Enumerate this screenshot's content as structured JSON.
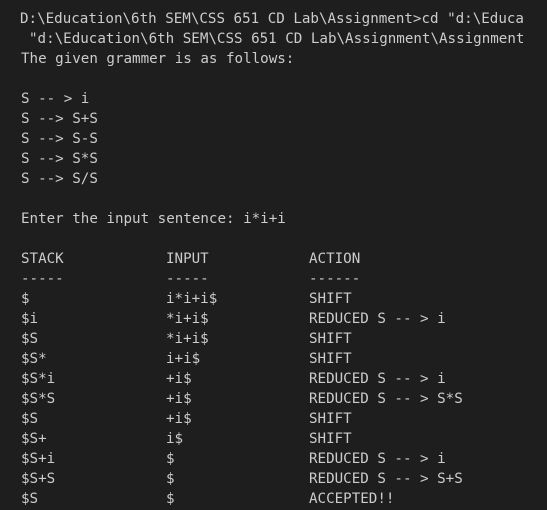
{
  "terminal": {
    "cmd_line_1": "D:\\Education\\6th SEM\\CSS 651 CD Lab\\Assignment>cd \"d:\\Educa",
    "cmd_line_2": "\"d:\\Education\\6th SEM\\CSS 651 CD Lab\\Assignment\\Assignment",
    "grammar_heading": "The given grammer is as follows:",
    "productions": [
      "S -- > i",
      "S --> S+S",
      "S --> S-S",
      "S --> S*S",
      "S --> S/S"
    ],
    "input_prompt": "Enter the input sentence: i*i+i",
    "table": {
      "headers": {
        "stack": "STACK",
        "input": "INPUT",
        "action": "ACTION"
      },
      "separators": {
        "stack": "-----",
        "input": "-----",
        "action": "------"
      },
      "rows": [
        {
          "stack": "$",
          "input": "i*i+i$",
          "action": "SHIFT"
        },
        {
          "stack": "$i",
          "input": "*i+i$",
          "action": "REDUCED S -- > i"
        },
        {
          "stack": "$S",
          "input": "*i+i$",
          "action": "SHIFT"
        },
        {
          "stack": "$S*",
          "input": "i+i$",
          "action": "SHIFT"
        },
        {
          "stack": "$S*i",
          "input": "+i$",
          "action": "REDUCED S -- > i"
        },
        {
          "stack": "$S*S",
          "input": "+i$",
          "action": "REDUCED S -- > S*S"
        },
        {
          "stack": "$S",
          "input": "+i$",
          "action": "SHIFT"
        },
        {
          "stack": "$S+",
          "input": "i$",
          "action": "SHIFT"
        },
        {
          "stack": "$S+i",
          "input": "$",
          "action": "REDUCED S -- > i"
        },
        {
          "stack": "$S+S",
          "input": "$",
          "action": "REDUCED S -- > S+S"
        },
        {
          "stack": "$S",
          "input": "$",
          "action": "ACCEPTED!!"
        }
      ]
    }
  }
}
